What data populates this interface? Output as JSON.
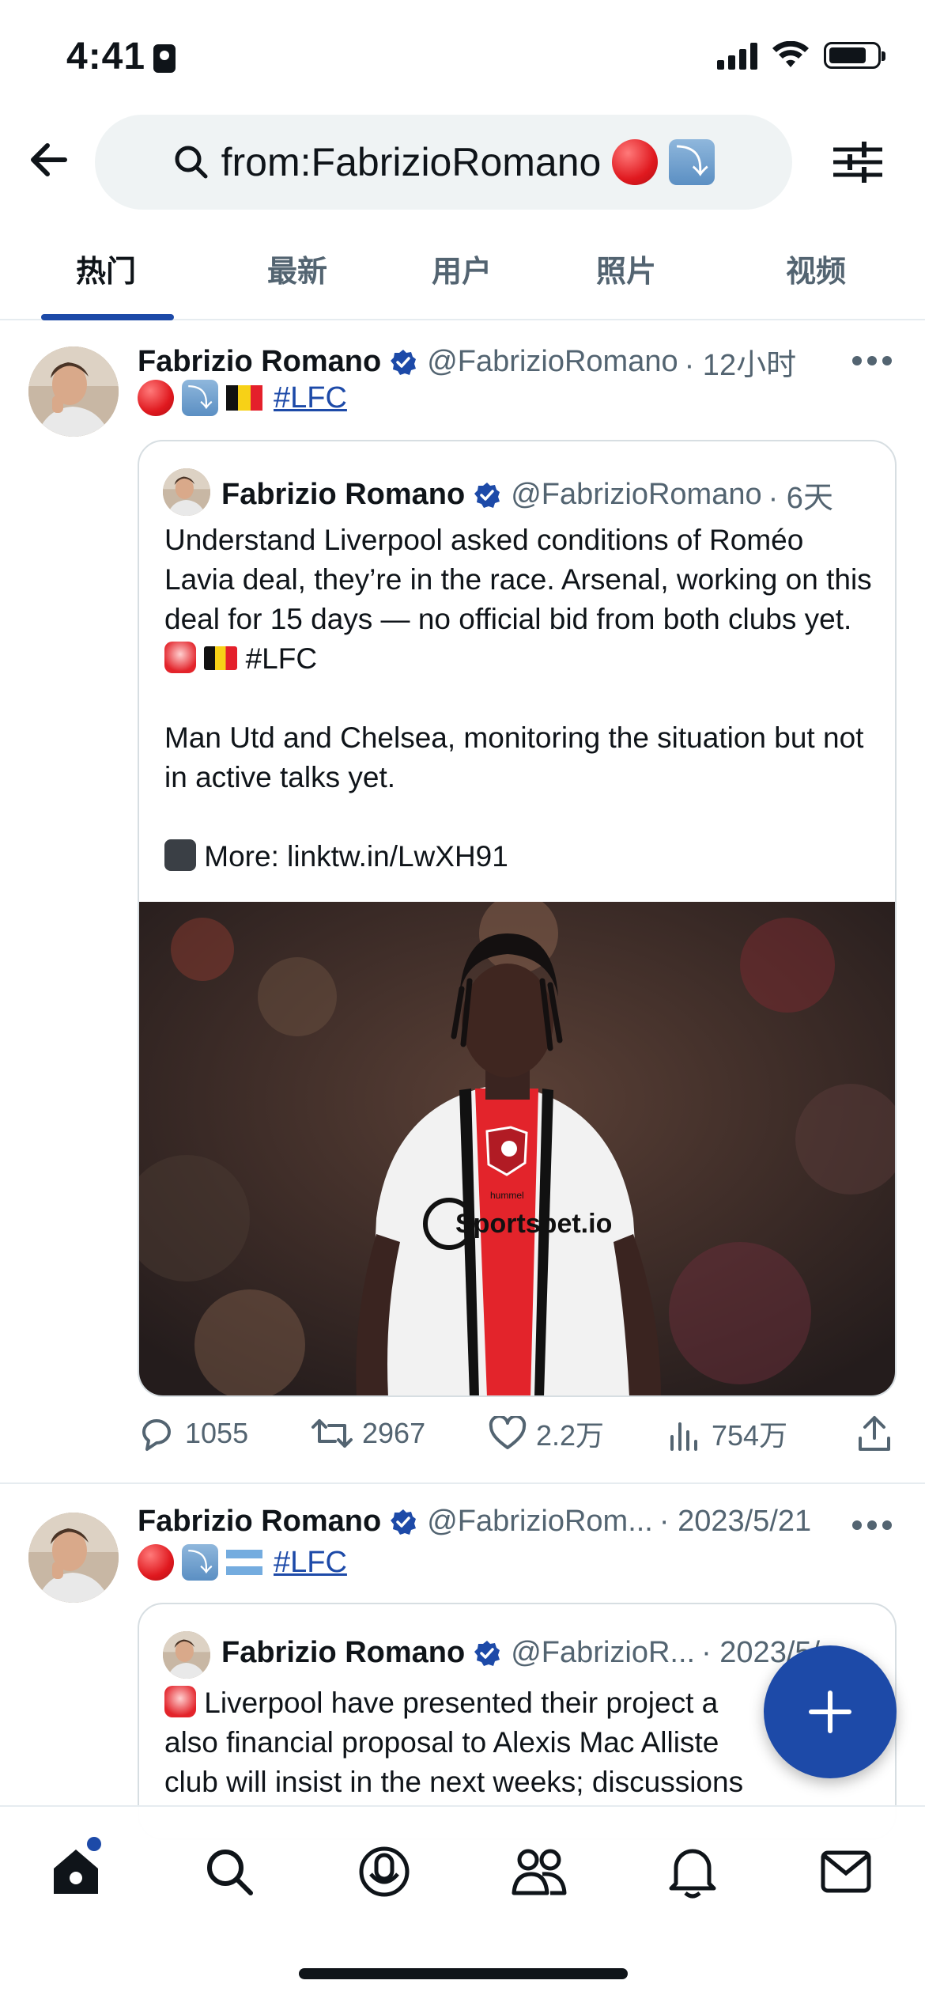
{
  "status_bar": {
    "time": "4:41"
  },
  "search": {
    "query": "from:FabrizioRomano"
  },
  "tabs": [
    {
      "label": "热门",
      "active": true
    },
    {
      "label": "最新",
      "active": false
    },
    {
      "label": "用户",
      "active": false
    },
    {
      "label": "照片",
      "active": false
    },
    {
      "label": "视频",
      "active": false
    }
  ],
  "tweets": [
    {
      "name": "Fabrizio Romano",
      "handle": "@FabrizioRomano",
      "time": "· 12小时",
      "hashtag": "#LFC",
      "quote": {
        "name": "Fabrizio Romano",
        "handle": "@FabrizioRomano",
        "time": "· 6天",
        "para1": "Understand Liverpool asked conditions of Roméo Lavia deal, they’re in the race. Arsenal, working on this deal for 15 days — no official bid from both clubs yet.",
        "para1_tail": "#LFC",
        "para2": "Man Utd and Chelsea, monitoring the situation but not in active talks yet.",
        "para3": "More: linktw.in/LwXH91",
        "photo_sponsor": "Sportsbet.io",
        "photo_brand": "hummel"
      },
      "replies": "1055",
      "retweets": "2967",
      "likes": "2.2万",
      "views": "754万"
    },
    {
      "name": "Fabrizio Romano",
      "handle": "@FabrizioRom...",
      "time": "· 2023/5/21",
      "hashtag": "#LFC",
      "quote": {
        "name": "Fabrizio Romano",
        "handle": "@FabrizioR...",
        "time": "· 2023/5/",
        "line1": "Liverpool have presented their project a",
        "line2": "also financial proposal to Alexis Mac Alliste",
        "line3": "club will insist in the next weeks; discussions"
      }
    }
  ],
  "colors": {
    "accent": "#1d4aa8",
    "text": "#0f1419",
    "muted": "#536471"
  }
}
